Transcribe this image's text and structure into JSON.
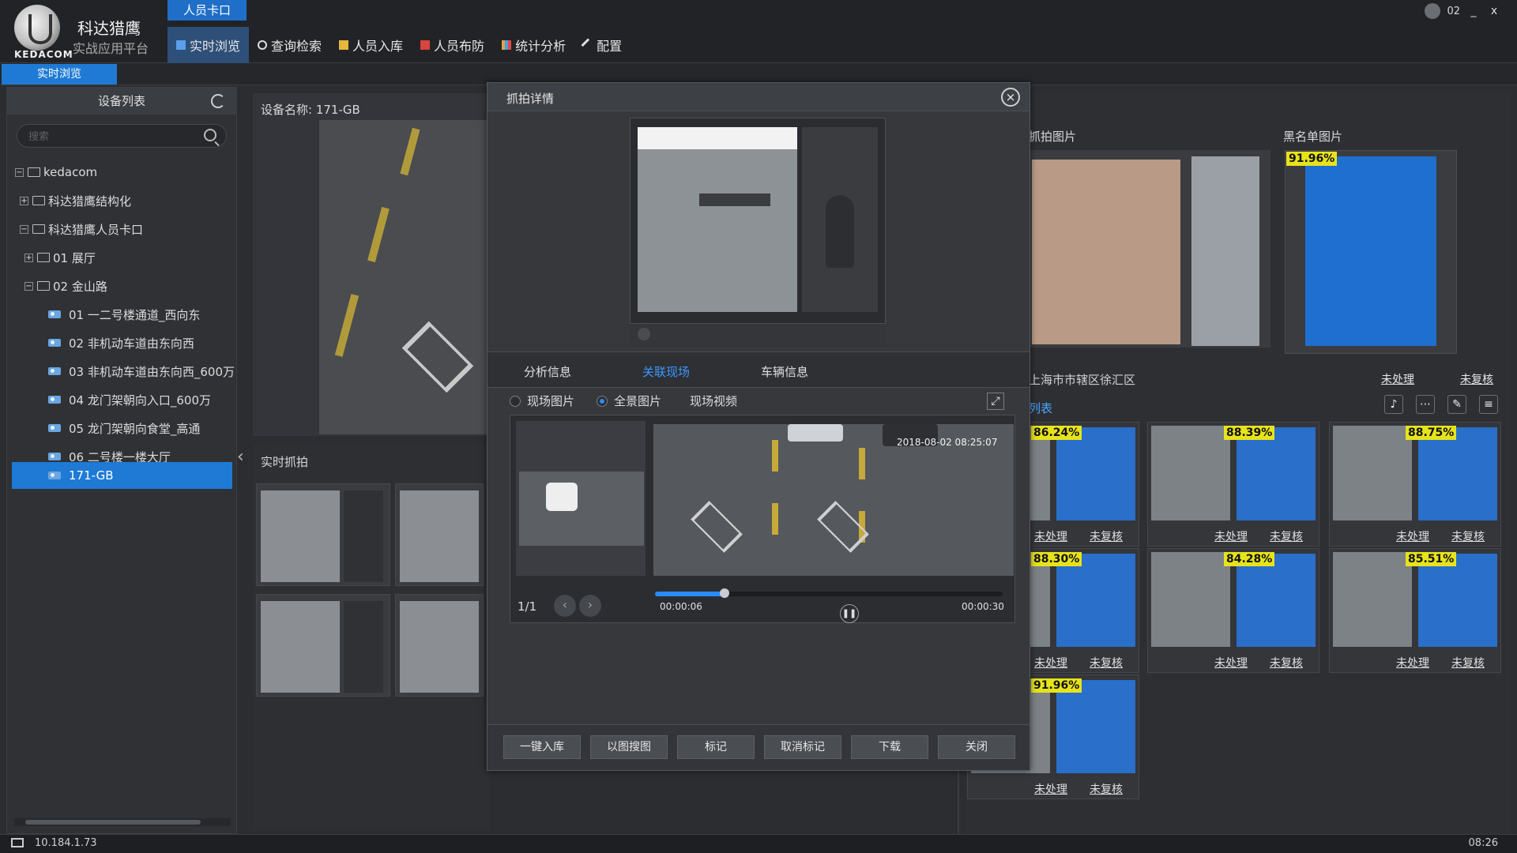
{
  "app": {
    "logo_text": "KEDACOM",
    "brand_name": "科达猎鹰",
    "brand_sub": "实战应用平台",
    "module_tab": "人员卡口",
    "user": "02",
    "win_min": "_",
    "win_close": "x"
  },
  "nav": {
    "items": [
      {
        "label": "实时浏览",
        "icon": "monitor-icon"
      },
      {
        "label": "查询检索",
        "icon": "search-icon"
      },
      {
        "label": "人员入库",
        "icon": "person-add-icon"
      },
      {
        "label": "人员布防",
        "icon": "shield-icon"
      },
      {
        "label": "统计分析",
        "icon": "bar-chart-icon"
      },
      {
        "label": "配置",
        "icon": "wrench-icon"
      }
    ]
  },
  "subtab": "实时浏览",
  "device_list": {
    "header": "设备列表",
    "search_placeholder": "搜索",
    "tree": [
      {
        "label": "kedacom",
        "exp": "−"
      },
      {
        "label": "科达猎鹰结构化",
        "exp": "+"
      },
      {
        "label": "科达猎鹰人员卡口",
        "exp": "−"
      },
      {
        "label": "01 展厅",
        "exp": "+"
      },
      {
        "label": "02 金山路",
        "exp": "−"
      },
      {
        "label": "01 一二号楼通道_西向东"
      },
      {
        "label": "02 非机动车道由东向西"
      },
      {
        "label": "03 非机动车道由东向西_600万"
      },
      {
        "label": "04 龙门架朝向入口_600万"
      },
      {
        "label": "05 龙门架朝向食堂_高通"
      },
      {
        "label": "06 二号楼一楼大厅"
      },
      {
        "label": "171-GB"
      }
    ]
  },
  "center": {
    "device_name": "设备名称: 171-GB",
    "realtime_label": "实时抓拍"
  },
  "right": {
    "snap_title": "抓拍图片",
    "black_title": "黑名单图片",
    "black_pct": "91.96%",
    "location": "上海市市辖区徐汇区",
    "unprocessed": "未处理",
    "unreviewed": "未复核",
    "list_label": "列表",
    "tools": [
      "bell-icon",
      "more-icon",
      "brush-icon",
      "menu-icon"
    ],
    "matches": [
      {
        "pct": "86.24%"
      },
      {
        "pct": "88.39%"
      },
      {
        "pct": "88.75%"
      },
      {
        "pct": "88.30%"
      },
      {
        "pct": "84.28%"
      },
      {
        "pct": "85.51%"
      },
      {
        "pct": "91.96%"
      }
    ]
  },
  "modal": {
    "title": "抓拍详情",
    "close": "×",
    "tabs": [
      "分析信息",
      "关联现场",
      "车辆信息"
    ],
    "active_tab": 1,
    "radios": [
      "现场图片",
      "全景图片",
      "现场视频"
    ],
    "radio_selected": 1,
    "page_indicator": "1/1",
    "prev": "‹",
    "next": "›",
    "timestamp": "2018-08-02 08:25:07",
    "time_start": "00:00:06",
    "time_end": "00:00:30",
    "progress": 0.2,
    "pause": "❚❚",
    "fullscreen": "⤢",
    "buttons": [
      "一键入库",
      "以图搜图",
      "标记",
      "取消标记",
      "下载",
      "关闭"
    ]
  },
  "status": {
    "ip": "10.184.1.73",
    "time": "08:26"
  }
}
